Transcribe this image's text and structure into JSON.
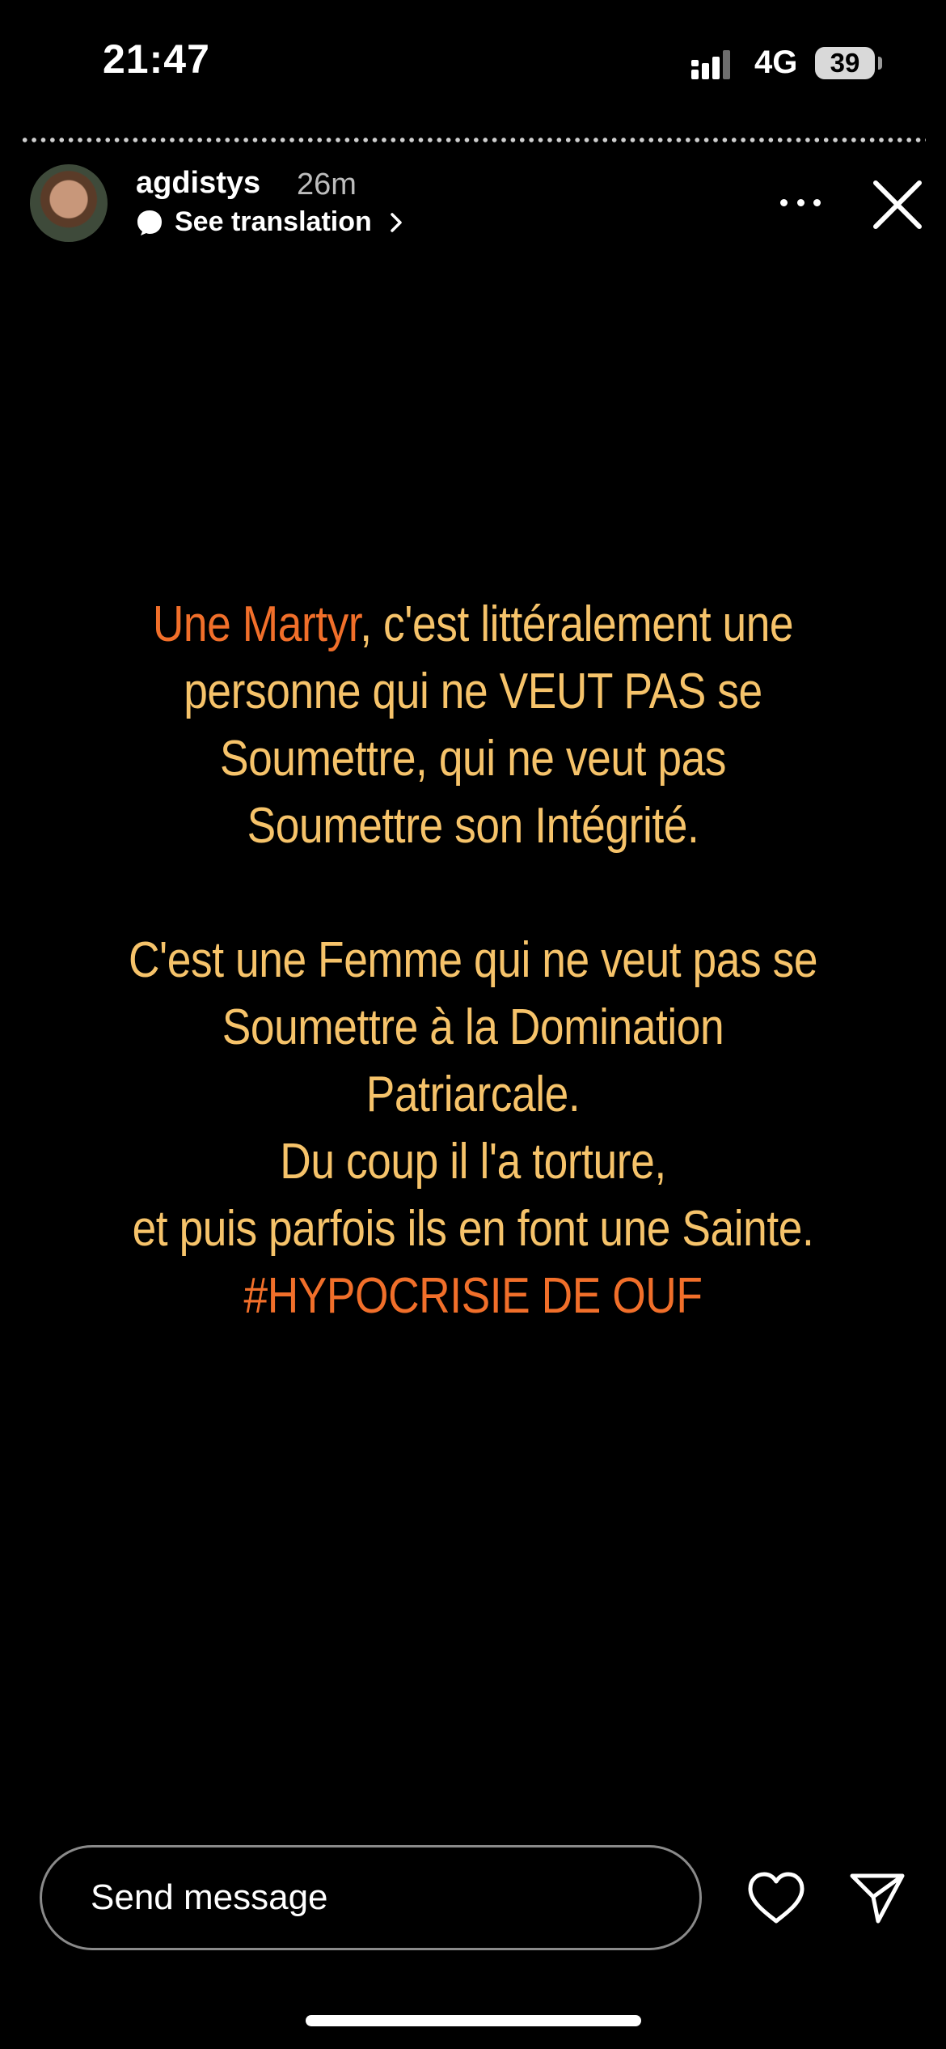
{
  "status_bar": {
    "time": "21:47",
    "network": "4G",
    "battery": "39"
  },
  "story": {
    "username": "agdistys",
    "time_ago": "26m",
    "see_translation": "See translation",
    "accent_color": "#f16f2a",
    "text_color": "#f6c36a",
    "text": {
      "p1_accent": "Une Martyr",
      "p1_rest": ", c'est littéralement une",
      "p1_line2": "personne qui ne VEUT PAS se",
      "p1_line3": "Soumettre, qui ne veut pas",
      "p1_line4": "Soumettre son Intégrité.",
      "p2_line1": "C'est une Femme qui ne veut pas se",
      "p2_line2": "Soumettre à la Domination",
      "p2_line3": "Patriarcale.",
      "p2_line4": "Du coup il l'a torture,",
      "p2_line5": "et puis parfois ils en font une Sainte.",
      "hashtag": "#HYPOCRISIE DE OUF"
    }
  },
  "composer": {
    "placeholder": "Send message"
  },
  "icons": {
    "more": "more-horizontal-icon",
    "close": "close-icon",
    "heart": "heart-icon",
    "share": "send-icon",
    "translate": "speech-bubble-icon"
  }
}
